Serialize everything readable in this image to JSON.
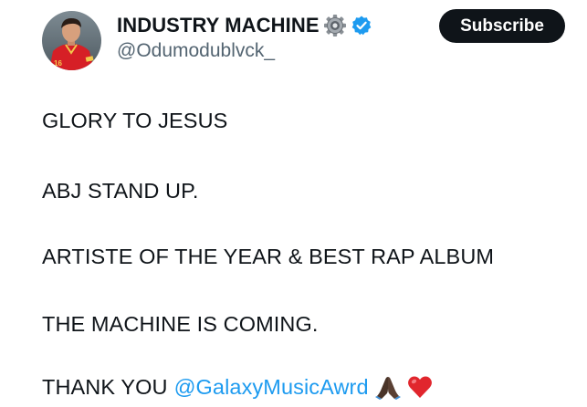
{
  "header": {
    "display_name": "INDUSTRY MACHINE",
    "handle": "@Odumodublvck_",
    "subscribe_label": "Subscribe",
    "icons": [
      "gear-icon",
      "verified-badge-icon"
    ],
    "avatar_jersey_number": "16"
  },
  "tweet": {
    "lines": [
      "GLORY TO JESUS",
      "ABJ STAND UP.",
      "ARTISTE OF THE YEAR & BEST RAP ALBUM",
      "THE MACHINE IS COMING."
    ],
    "last_line": {
      "text": "THANK YOU",
      "mention": "@GalaxyMusicAwrd",
      "emojis": [
        "praying-hands-icon",
        "red-heart-icon"
      ]
    }
  },
  "colors": {
    "text": "#0f1419",
    "secondary_text": "#536471",
    "link": "#1d9bf0",
    "verified": "#1d9bf0",
    "button_bg": "#0f1419",
    "button_text": "#ffffff"
  }
}
